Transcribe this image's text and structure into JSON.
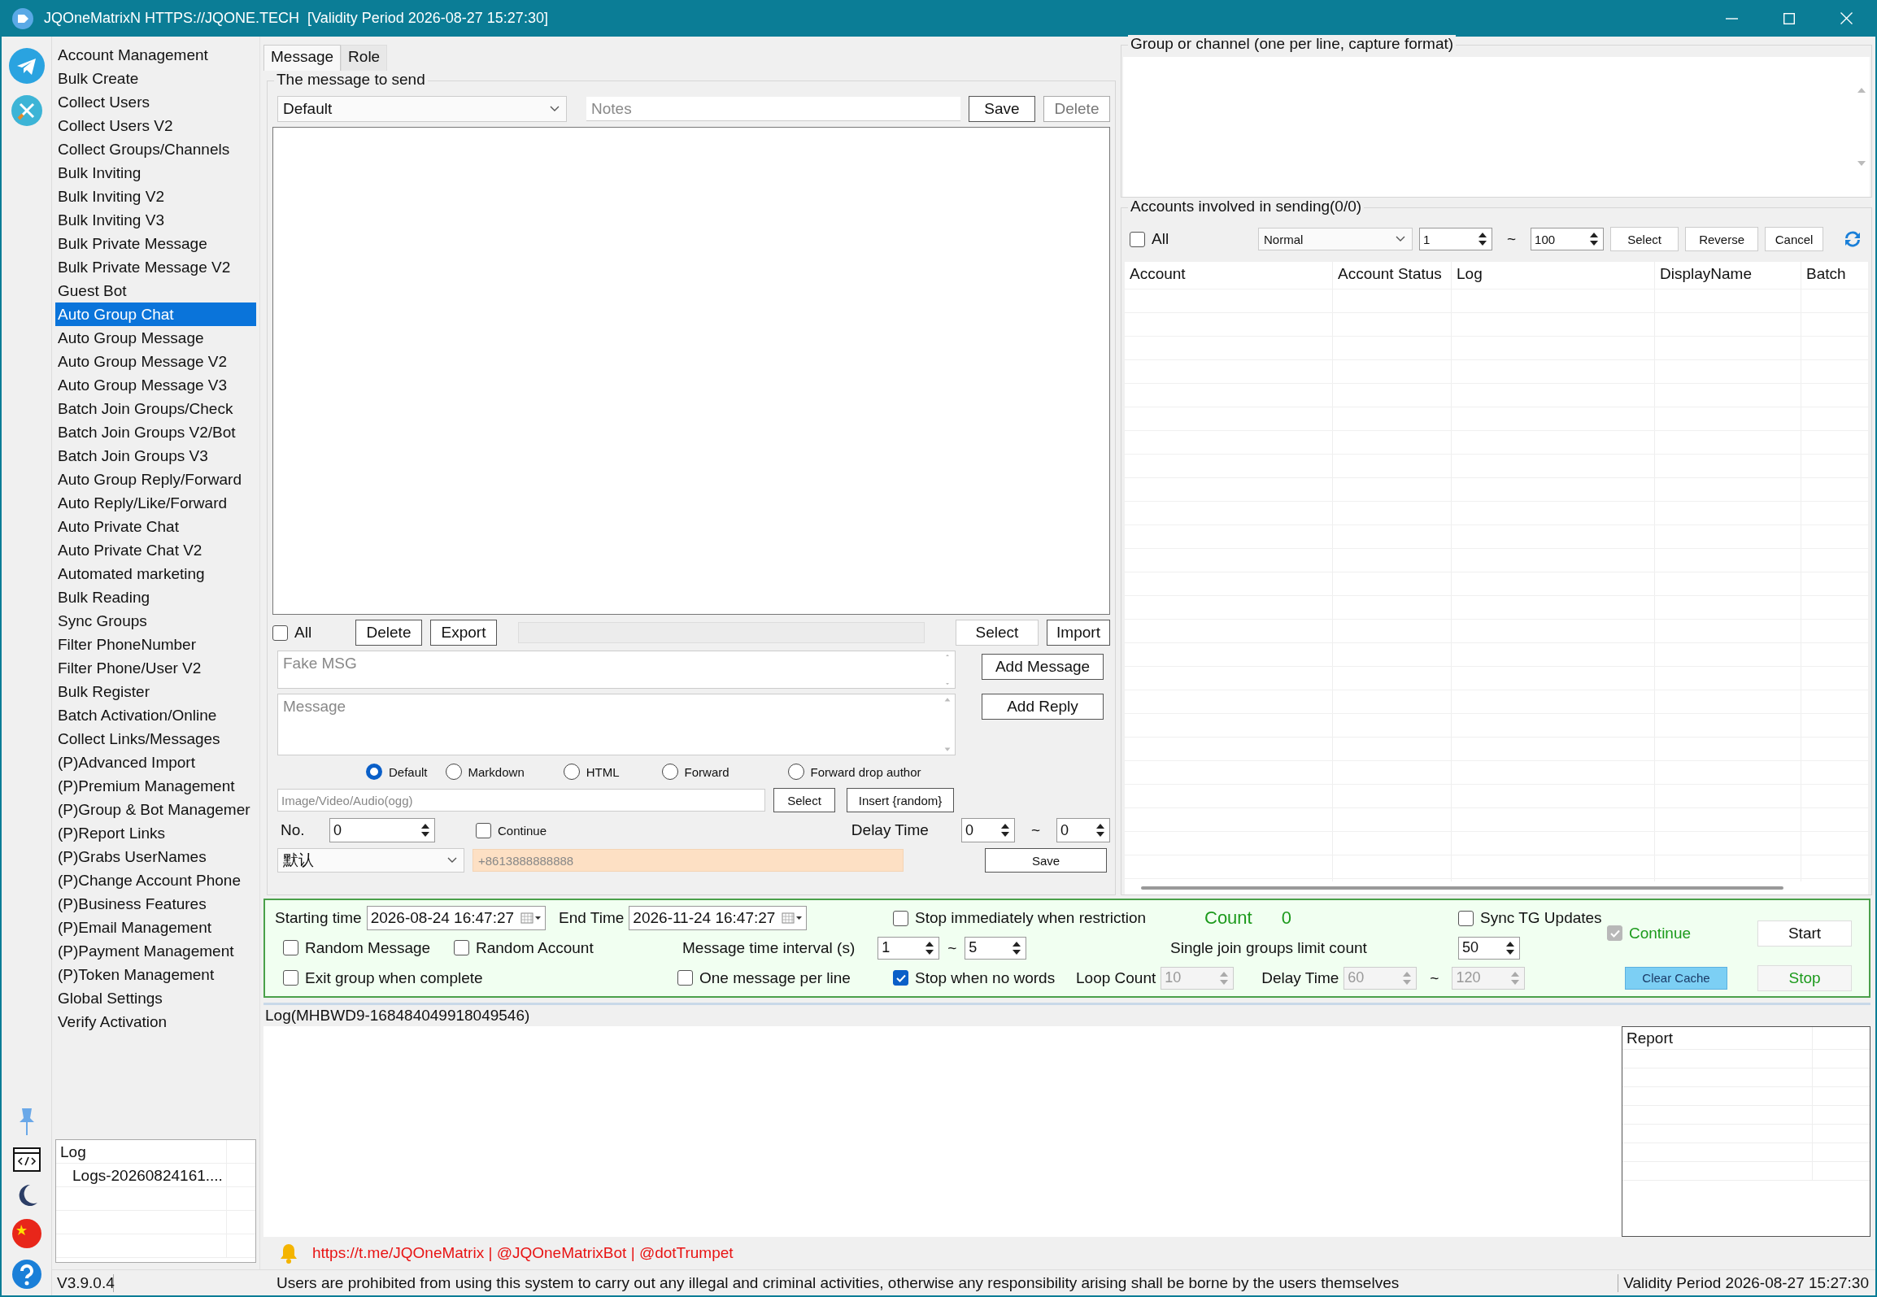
{
  "window": {
    "title": "JQOneMatrixN HTTPS://JQONE.TECH  [Validity Period 2026-08-27 15:27:30]"
  },
  "sidebar": {
    "items": [
      {
        "label": "Account Management",
        "selected": false
      },
      {
        "label": "Bulk Create",
        "selected": false
      },
      {
        "label": "Collect Users",
        "selected": false
      },
      {
        "label": "Collect Users V2",
        "selected": false
      },
      {
        "label": "Collect Groups/Channels",
        "selected": false
      },
      {
        "label": "Bulk Inviting",
        "selected": false
      },
      {
        "label": "Bulk Inviting V2",
        "selected": false
      },
      {
        "label": "Bulk Inviting V3",
        "selected": false
      },
      {
        "label": "Bulk Private Message",
        "selected": false
      },
      {
        "label": "Bulk Private Message V2",
        "selected": false
      },
      {
        "label": "Guest Bot",
        "selected": false
      },
      {
        "label": "Auto Group Chat",
        "selected": true
      },
      {
        "label": "Auto Group Message",
        "selected": false
      },
      {
        "label": "Auto Group Message V2",
        "selected": false
      },
      {
        "label": "Auto Group Message V3",
        "selected": false
      },
      {
        "label": "Batch Join Groups/Check",
        "selected": false
      },
      {
        "label": "Batch Join Groups V2/Bot",
        "selected": false
      },
      {
        "label": "Batch Join Groups V3",
        "selected": false
      },
      {
        "label": "Auto Group Reply/Forward",
        "selected": false
      },
      {
        "label": "Auto Reply/Like/Forward",
        "selected": false
      },
      {
        "label": "Auto Private Chat",
        "selected": false
      },
      {
        "label": "Auto Private Chat V2",
        "selected": false
      },
      {
        "label": "Automated marketing",
        "selected": false
      },
      {
        "label": "Bulk Reading",
        "selected": false
      },
      {
        "label": "Sync Groups",
        "selected": false
      },
      {
        "label": "Filter PhoneNumber",
        "selected": false
      },
      {
        "label": "Filter Phone/User V2",
        "selected": false
      },
      {
        "label": "Bulk Register",
        "selected": false
      },
      {
        "label": "Batch Activation/Online",
        "selected": false
      },
      {
        "label": "Collect Links/Messages",
        "selected": false
      },
      {
        "label": "(P)Advanced Import",
        "selected": false
      },
      {
        "label": "(P)Premium Management",
        "selected": false
      },
      {
        "label": "(P)Group & Bot Managemer",
        "selected": false
      },
      {
        "label": "(P)Report Links",
        "selected": false
      },
      {
        "label": "(P)Grabs UserNames",
        "selected": false
      },
      {
        "label": "(P)Change Account Phone",
        "selected": false
      },
      {
        "label": "(P)Business Features",
        "selected": false
      },
      {
        "label": "(P)Email Management",
        "selected": false
      },
      {
        "label": "(P)Payment Management",
        "selected": false
      },
      {
        "label": "(P)Token Management",
        "selected": false
      },
      {
        "label": "Global Settings",
        "selected": false
      },
      {
        "label": "Verify Activation",
        "selected": false
      }
    ],
    "log_panel": {
      "header": "Log",
      "items": [
        "Logs-20260824161...."
      ]
    }
  },
  "tabs": [
    {
      "label": "Message",
      "selected": true
    },
    {
      "label": "Role",
      "selected": false
    }
  ],
  "message_panel": {
    "title": "The message to send",
    "template": "Default",
    "notes_placeholder": "Notes",
    "save": "Save",
    "delete": "Delete",
    "all": {
      "label": "All",
      "checked": false
    },
    "list_delete": "Delete",
    "export": "Export",
    "progress": {
      "level": 0
    },
    "select": "Select",
    "import": "Import",
    "fake_msg_placeholder": "Fake MSG",
    "message_placeholder": "Message",
    "add_message": "Add Message",
    "add_reply": "Add Reply",
    "formats": [
      {
        "label": "Default",
        "selected": true
      },
      {
        "label": "Markdown",
        "selected": false
      },
      {
        "label": "HTML",
        "selected": false
      },
      {
        "label": "Forward",
        "selected": false
      },
      {
        "label": "Forward drop author",
        "selected": false
      }
    ],
    "media_placeholder": "Image/Video/Audio(ogg)",
    "media_select": "Select",
    "insert_random": "Insert {random}",
    "no_label": "No.",
    "no_value": "0",
    "continue": {
      "label": "Continue",
      "checked": false
    },
    "delay_label": "Delay Time",
    "delay_from": "0",
    "tilde": "~",
    "delay_to": "0",
    "language": "默认",
    "phone_placeholder": "+8613888888888",
    "bottom_save": "Save"
  },
  "groups_panel": {
    "title": "Group or channel (one per line, capture format)"
  },
  "accounts_panel": {
    "title": "Accounts involved in sending(0/0)",
    "all": {
      "label": "All",
      "checked": false
    },
    "mode": "Normal",
    "from": "1",
    "tilde": "~",
    "to": "100",
    "select": "Select",
    "reverse": "Reverse",
    "cancel": "Cancel",
    "columns": [
      "Account",
      "Account Status",
      "Log",
      "DisplayName",
      "Batch"
    ]
  },
  "schedule": {
    "start_label": "Starting time",
    "start": "2026-08-24 16:47:27",
    "end_label": "End Time",
    "end": "2026-11-24 16:47:27",
    "stop_restriction": {
      "label": "Stop immediately when restriction",
      "checked": false
    },
    "count_label": "Count",
    "count": "0",
    "sync_tg": {
      "label": "Sync TG Updates",
      "checked": false
    },
    "continue": {
      "label": "Continue",
      "checked": true,
      "disabled": true
    },
    "start_button": "Start",
    "random_message": {
      "label": "Random Message",
      "checked": false
    },
    "random_account": {
      "label": "Random Account",
      "checked": false
    },
    "interval_label": "Message time interval (s)",
    "interval_from": {
      "value": "1",
      "disabled": false
    },
    "interval_tilde": "~",
    "interval_to": {
      "value": "5",
      "disabled": false
    },
    "limit_label": "Single join groups limit count",
    "limit": {
      "value": "50",
      "disabled": false
    },
    "exit_group": {
      "label": "Exit group when complete",
      "checked": false
    },
    "one_per_line": {
      "label": "One message per line",
      "checked": false
    },
    "stop_no_words": {
      "label": "Stop when no words",
      "checked": true
    },
    "loop_label": "Loop Count",
    "loop": {
      "value": "10",
      "disabled": true
    },
    "delay_label": "Delay Time",
    "delay_from": {
      "value": "60",
      "disabled": true
    },
    "delay_tilde": "~",
    "delay_to": {
      "value": "120",
      "disabled": true
    },
    "clear_cache": "Clear Cache",
    "stop_button": "Stop"
  },
  "log": {
    "title": "Log(MHBWD9-168484049918049546)",
    "report_header": "Report"
  },
  "links": "https://t.me/JQOneMatrix | @JQOneMatrixBot | @dotTrumpet",
  "status_bar": {
    "version": "V3.9.0.4",
    "notice": "Users are prohibited from using this system to carry out any illegal and criminal activities, otherwise any responsibility arising shall be borne by the users themselves",
    "validity": "Validity Period 2026-08-27 15:27:30"
  }
}
